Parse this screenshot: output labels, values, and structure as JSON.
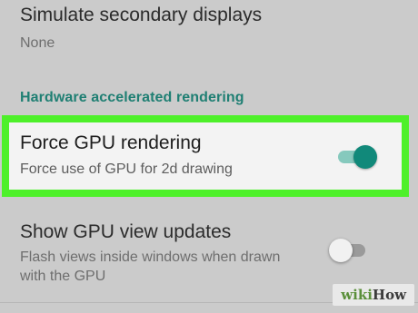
{
  "settings": {
    "secondary_displays": {
      "title": "Simulate secondary displays",
      "summary": "None"
    },
    "category": "Hardware accelerated rendering",
    "force_gpu": {
      "title": "Force GPU rendering",
      "summary": "Force use of GPU for 2d drawing",
      "enabled": true
    },
    "gpu_view_updates": {
      "title": "Show GPU view updates",
      "summary": "Flash views inside windows when drawn with the GPU",
      "enabled": false
    }
  },
  "colors": {
    "highlight_border": "#4ef02a",
    "accent": "#11897a",
    "category_text": "#1f7f73"
  },
  "watermark": {
    "part1": "wiki",
    "part2": "How"
  }
}
